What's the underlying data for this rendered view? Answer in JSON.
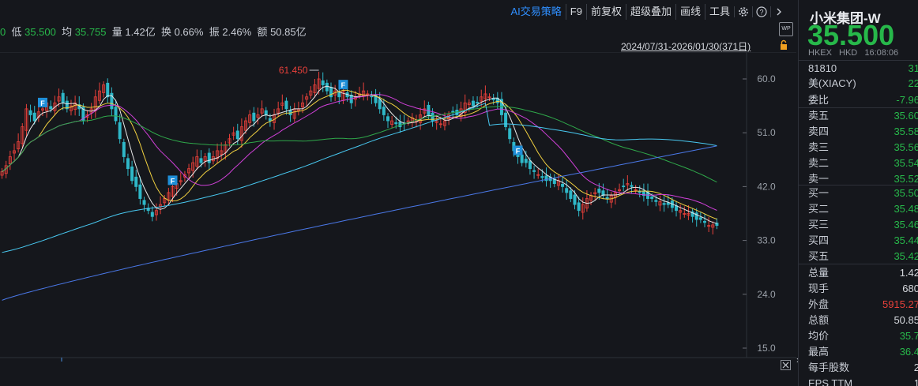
{
  "toolbar": {
    "ai": "AI交易策略",
    "f9": "F9",
    "qfq": "前复权",
    "overlay": "超级叠加",
    "draw": "画线",
    "tools": "工具"
  },
  "stats": {
    "lead": "0",
    "low_label": "低",
    "low_value": "35.500",
    "avg_label": "均",
    "avg_value": "35.755",
    "vol_label": "量",
    "vol_value": "1.42亿",
    "turn_label": "换",
    "turn_value": "0.66%",
    "amp_label": "振",
    "amp_value": "2.46%",
    "amt_label": "额",
    "amt_value": "50.85亿"
  },
  "wp_label": "WP",
  "range": "2024/07/31-2026/01/30(371日)",
  "chart_data": {
    "type": "candlestick",
    "y_ticks": [
      "60.0",
      "51.0",
      "42.0",
      "33.0",
      "24.0",
      "15.0"
    ],
    "ylim": [
      15.0,
      60.0
    ],
    "high_label": "61.450",
    "flag_label": "F",
    "closes": [
      44.5,
      45.5,
      47,
      48,
      49.5,
      52,
      55,
      54,
      53,
      54.5,
      55,
      56,
      55,
      56,
      57,
      56,
      55,
      55.5,
      56,
      55,
      53,
      54,
      55,
      57,
      58,
      59,
      57,
      55,
      53,
      50,
      47,
      45,
      43,
      42,
      40,
      39,
      38,
      37,
      38,
      39,
      40,
      41,
      42,
      42.5,
      43,
      44,
      45,
      46,
      47,
      46,
      47,
      46,
      47,
      48,
      48,
      49,
      50,
      51,
      50,
      52,
      53,
      54,
      53,
      54,
      55,
      54,
      53,
      54,
      55,
      56,
      55,
      54,
      55,
      55,
      56,
      57,
      58,
      59,
      60,
      59,
      58,
      57,
      58,
      57,
      58,
      57,
      56,
      57,
      57.5,
      58,
      57.5,
      57,
      56,
      55,
      54,
      53,
      53,
      52.5,
      52,
      52.5,
      53,
      53.5,
      53,
      54,
      55,
      54,
      53,
      53,
      52.5,
      53,
      54,
      54.5,
      54,
      55,
      56,
      56,
      55.5,
      56,
      57,
      57.5,
      57,
      56.5,
      56,
      54,
      52,
      50,
      48,
      47,
      46,
      46,
      45,
      44.5,
      44,
      43.5,
      43,
      43,
      42.5,
      43,
      42,
      41,
      40,
      39,
      38,
      39,
      40,
      40.5,
      41,
      41,
      40.5,
      40,
      40.5,
      41,
      41.5,
      42,
      42.5,
      42,
      41.5,
      41,
      40.5,
      40,
      40,
      39.5,
      39.5,
      39,
      39,
      38.5,
      38,
      38,
      37.5,
      37.5,
      37,
      36.5,
      36.5,
      36,
      35.5,
      35.6,
      35.5
    ]
  },
  "side": {
    "name": "小米集团-W",
    "price": "35.500",
    "exch": "HKEX",
    "cur": "HKD",
    "time": "16:08:06",
    "code_label": "81810",
    "code_value": "31",
    "adr_label": "美(XIACY)",
    "adr_value": "22",
    "wb_label": "委比",
    "wb_value": "-7.96",
    "asks": [
      {
        "label": "卖五",
        "price": "35.60"
      },
      {
        "label": "卖四",
        "price": "35.58"
      },
      {
        "label": "卖三",
        "price": "35.56"
      },
      {
        "label": "卖二",
        "price": "35.54"
      },
      {
        "label": "卖一",
        "price": "35.52"
      }
    ],
    "bids": [
      {
        "label": "买一",
        "price": "35.50"
      },
      {
        "label": "买二",
        "price": "35.48"
      },
      {
        "label": "买三",
        "price": "35.46"
      },
      {
        "label": "买四",
        "price": "35.44"
      },
      {
        "label": "买五",
        "price": "35.42"
      }
    ],
    "info": [
      {
        "label": "总量",
        "value": "1.42",
        "color": "#d6d9de"
      },
      {
        "label": "现手",
        "value": "680",
        "color": "#d6d9de"
      },
      {
        "label": "外盘",
        "value": "5915.27",
        "color": "#e8403a"
      },
      {
        "label": "总额",
        "value": "50.85",
        "color": "#d6d9de"
      },
      {
        "label": "均价",
        "value": "35.7",
        "color": "#27b84a"
      },
      {
        "label": "最高",
        "value": "36.4",
        "color": "#27b84a"
      },
      {
        "label": "每手股数",
        "value": "2",
        "color": "#d6d9de"
      },
      {
        "label": "EPS TTM",
        "value": "1",
        "color": "#d6d9de"
      }
    ]
  },
  "more_label": "»",
  "colors": {
    "up": "#e8403a",
    "down": "#27b84a",
    "accent": "#2f8fff"
  }
}
